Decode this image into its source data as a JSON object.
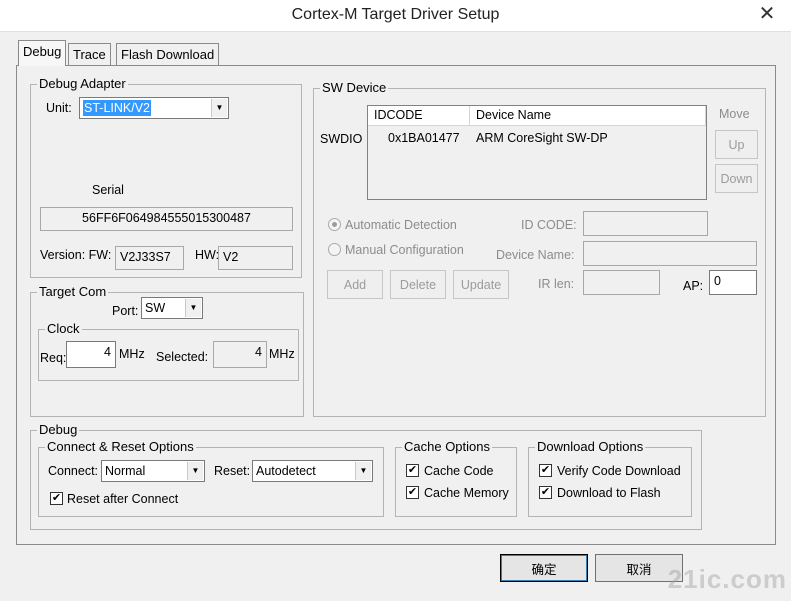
{
  "window": {
    "title": "Cortex-M Target Driver Setup",
    "close_icon": "close-icon"
  },
  "tabs": [
    {
      "label": "Debug",
      "active": true
    },
    {
      "label": "Trace",
      "active": false
    },
    {
      "label": "Flash Download",
      "active": false
    }
  ],
  "debug_adapter": {
    "title": "Debug Adapter",
    "unit_label": "Unit:",
    "unit_value": "ST-LINK/V2",
    "serial_label": "Serial",
    "serial_value": "56FF6F064984555015300487",
    "version_label": "Version: FW:",
    "fw_value": "V2J33S7",
    "hw_label": "HW:",
    "hw_value": "V2"
  },
  "target_com": {
    "title": "Target Com",
    "port_label": "Port:",
    "port_value": "SW",
    "clock": {
      "title": "Clock",
      "req_label": "Req:",
      "req_value": "4",
      "req_unit": "MHz",
      "selected_label": "Selected:",
      "selected_value": "4",
      "selected_unit": "MHz"
    }
  },
  "sw_device": {
    "title": "SW Device",
    "swdio_label": "SWDIO",
    "columns": [
      "IDCODE",
      "Device Name"
    ],
    "rows": [
      {
        "idcode": "0x1BA01477",
        "device_name": "ARM CoreSight SW-DP"
      }
    ],
    "move_label": "Move",
    "up_label": "Up",
    "down_label": "Down",
    "auto_detection_label": "Automatic Detection",
    "manual_config_label": "Manual Configuration",
    "id_code_label": "ID CODE:",
    "id_code_value": "",
    "device_name_label": "Device Name:",
    "device_name_value": "",
    "ir_len_label": "IR len:",
    "ir_len_value": "",
    "ap_label": "AP:",
    "ap_value": "0",
    "add_label": "Add",
    "delete_label": "Delete",
    "update_label": "Update"
  },
  "debug": {
    "title": "Debug",
    "connect_reset": {
      "title": "Connect & Reset Options",
      "connect_label": "Connect:",
      "connect_value": "Normal",
      "reset_label": "Reset:",
      "reset_value": "Autodetect",
      "reset_after_connect_label": "Reset after Connect",
      "reset_after_connect_checked": true
    },
    "cache_options": {
      "title": "Cache Options",
      "cache_code_label": "Cache Code",
      "cache_code_checked": true,
      "cache_memory_label": "Cache Memory",
      "cache_memory_checked": true
    },
    "download_options": {
      "title": "Download Options",
      "verify_label": "Verify Code Download",
      "verify_checked": true,
      "download_flash_label": "Download to Flash",
      "download_flash_checked": true
    }
  },
  "footer": {
    "ok_label": "确定",
    "cancel_label": "取消",
    "watermark": "21ic.com"
  }
}
